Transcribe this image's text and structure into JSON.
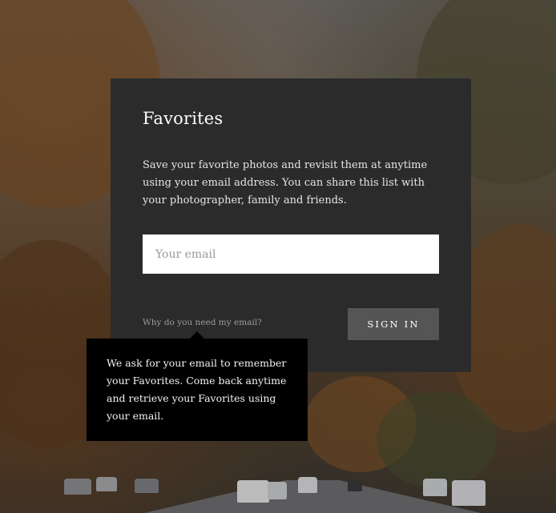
{
  "favorites_dialog": {
    "title": "Favorites",
    "description": "Save your favorite photos and revisit them at anytime using your email address. You can share this list with your photographer, family and friends.",
    "email_input": {
      "value": "",
      "placeholder": "Your email"
    },
    "why_link": "Why do you need my email?",
    "sign_in_button": "SIGN IN"
  },
  "tooltip": {
    "text": "We ask for your email to remember your Favorites. Come back anytime and retrieve your Favorites using your email."
  },
  "colors": {
    "panel_background": "#2b2b2c",
    "tooltip_background": "#000000",
    "button_background": "#555556",
    "link_text": "#9b9b9b"
  }
}
